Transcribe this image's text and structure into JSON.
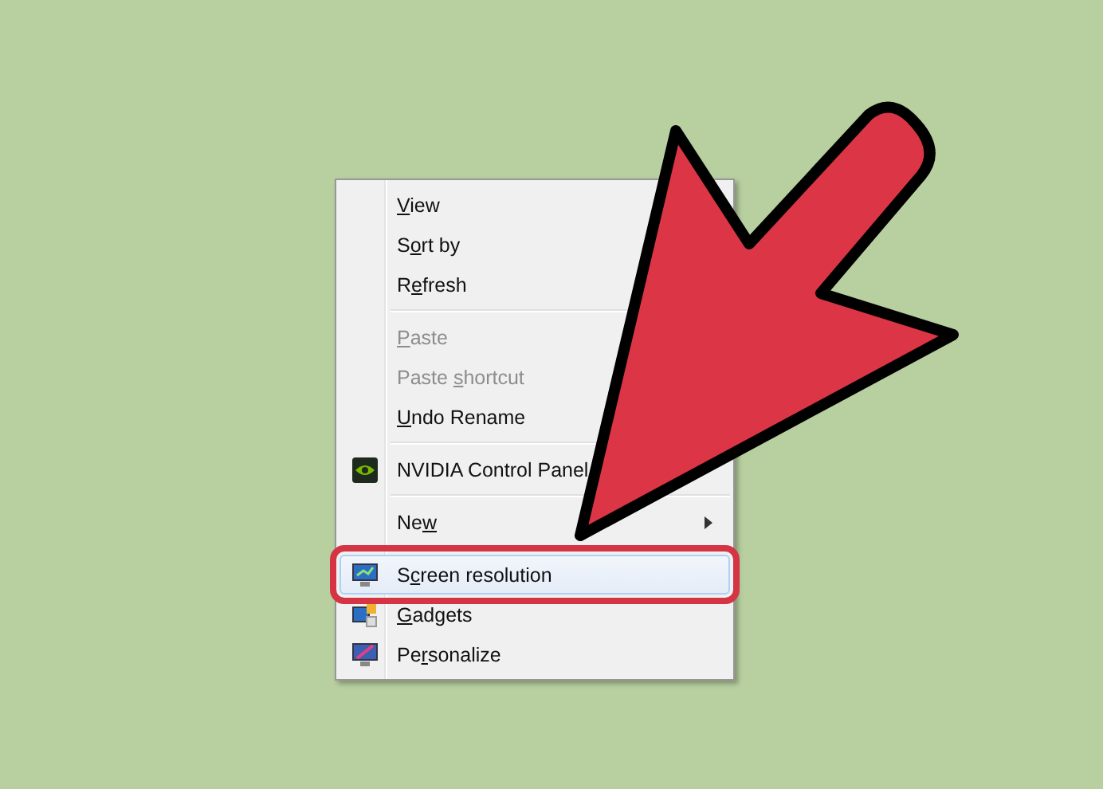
{
  "context_menu": {
    "sections": [
      [
        {
          "kind": "plain",
          "key": "V",
          "after": "iew",
          "disabled": false,
          "selected": false
        },
        {
          "kind": "plain",
          "before": "S",
          "key": "o",
          "after": "rt by",
          "disabled": false,
          "selected": false
        },
        {
          "kind": "plain",
          "before": "R",
          "key": "e",
          "after": "fresh",
          "disabled": false,
          "selected": false
        }
      ],
      [
        {
          "kind": "plain",
          "key": "P",
          "after": "aste",
          "disabled": true,
          "selected": false
        },
        {
          "kind": "plain",
          "before": "Paste ",
          "key": "s",
          "after": "hortcut",
          "disabled": true,
          "selected": false
        },
        {
          "kind": "plain",
          "key": "U",
          "after": "ndo Rename",
          "disabled": false,
          "selected": false
        }
      ],
      [
        {
          "kind": "nvidia",
          "before": "NVIDIA Control Panel",
          "disabled": false,
          "selected": false
        }
      ],
      [
        {
          "kind": "submenu",
          "before": "Ne",
          "key": "w",
          "disabled": false,
          "selected": false
        }
      ],
      [
        {
          "kind": "monitor",
          "before": "S",
          "key": "c",
          "after": "reen resolution",
          "disabled": false,
          "selected": true
        },
        {
          "kind": "gadgets",
          "key": "G",
          "after": "adgets",
          "disabled": false,
          "selected": false
        },
        {
          "kind": "personalize",
          "before": "Pe",
          "key": "r",
          "after": "sonalize",
          "disabled": false,
          "selected": false
        }
      ]
    ]
  }
}
